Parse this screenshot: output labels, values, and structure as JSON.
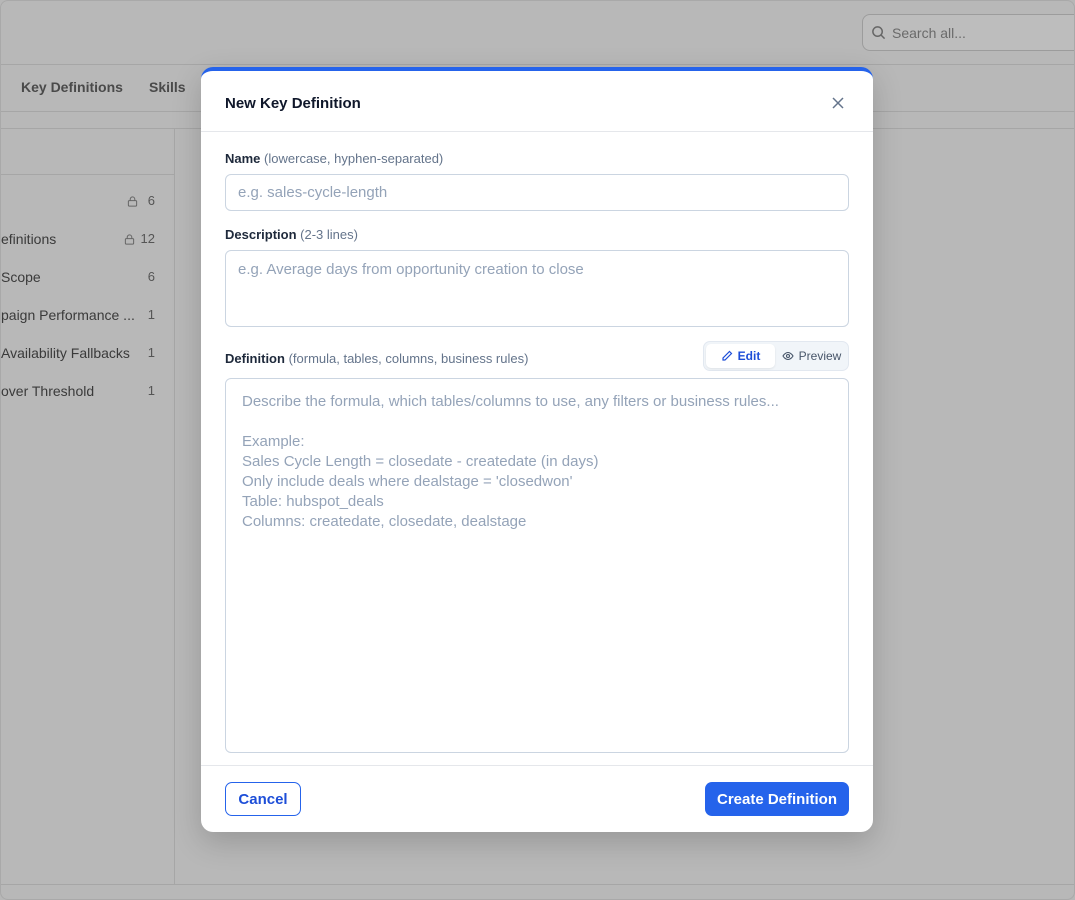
{
  "background": {
    "search_placeholder": "Search all...",
    "tabs": [
      {
        "label": "Key Definitions"
      },
      {
        "label": "Skills"
      }
    ],
    "sidebar_items": [
      {
        "label": "",
        "count": "6",
        "locked": true
      },
      {
        "label": "efinitions",
        "count": "12",
        "locked": true
      },
      {
        "label": "Scope",
        "count": "6",
        "locked": false
      },
      {
        "label": "paign Performance ...",
        "count": "1",
        "locked": false
      },
      {
        "label": "Availability Fallbacks",
        "count": "1",
        "locked": false
      },
      {
        "label": "over Threshold",
        "count": "1",
        "locked": false
      }
    ]
  },
  "modal": {
    "title": "New Key Definition",
    "name_field": {
      "label": "Name",
      "hint": "(lowercase, hyphen-separated)",
      "placeholder": "e.g. sales-cycle-length",
      "value": ""
    },
    "description_field": {
      "label": "Description",
      "hint": "(2-3 lines)",
      "placeholder": "e.g. Average days from opportunity creation to close",
      "value": ""
    },
    "definition_field": {
      "label": "Definition",
      "hint": "(formula, tables, columns, business rules)",
      "placeholder": "Describe the formula, which tables/columns to use, any filters or business rules...\n\nExample:\nSales Cycle Length = closedate - createdate (in days)\nOnly include deals where dealstage = 'closedwon'\nTable: hubspot_deals\nColumns: createdate, closedate, dealstage",
      "value": ""
    },
    "mode_toggle": {
      "edit_label": "Edit",
      "preview_label": "Preview",
      "active": "edit"
    },
    "footer": {
      "cancel_label": "Cancel",
      "create_label": "Create Definition"
    }
  },
  "colors": {
    "accent": "#2563eb",
    "overlay": "#b8b8b8"
  }
}
